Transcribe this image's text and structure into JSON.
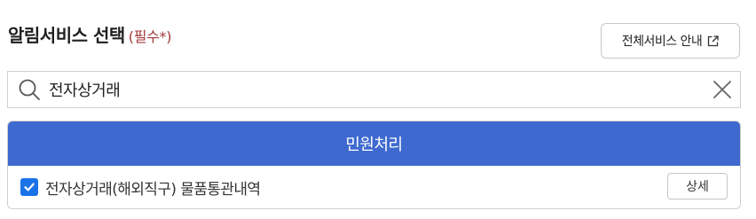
{
  "section": {
    "title": "알림서비스 선택",
    "required_label": "(필수*)"
  },
  "all_services_button": {
    "label": "전체서비스 안내",
    "icon": "external-link-icon"
  },
  "search": {
    "value": "전자상거래",
    "icon": "search-icon",
    "clear_icon": "close-icon"
  },
  "results": {
    "category": "민원처리",
    "items": [
      {
        "label": "전자상거래(해외직구) 물품통관내역",
        "checked": true,
        "detail_label": "상세"
      }
    ]
  },
  "colors": {
    "header_bg": "#3e69cf",
    "required": "#a23a3a",
    "checkbox": "#1a73e8"
  }
}
